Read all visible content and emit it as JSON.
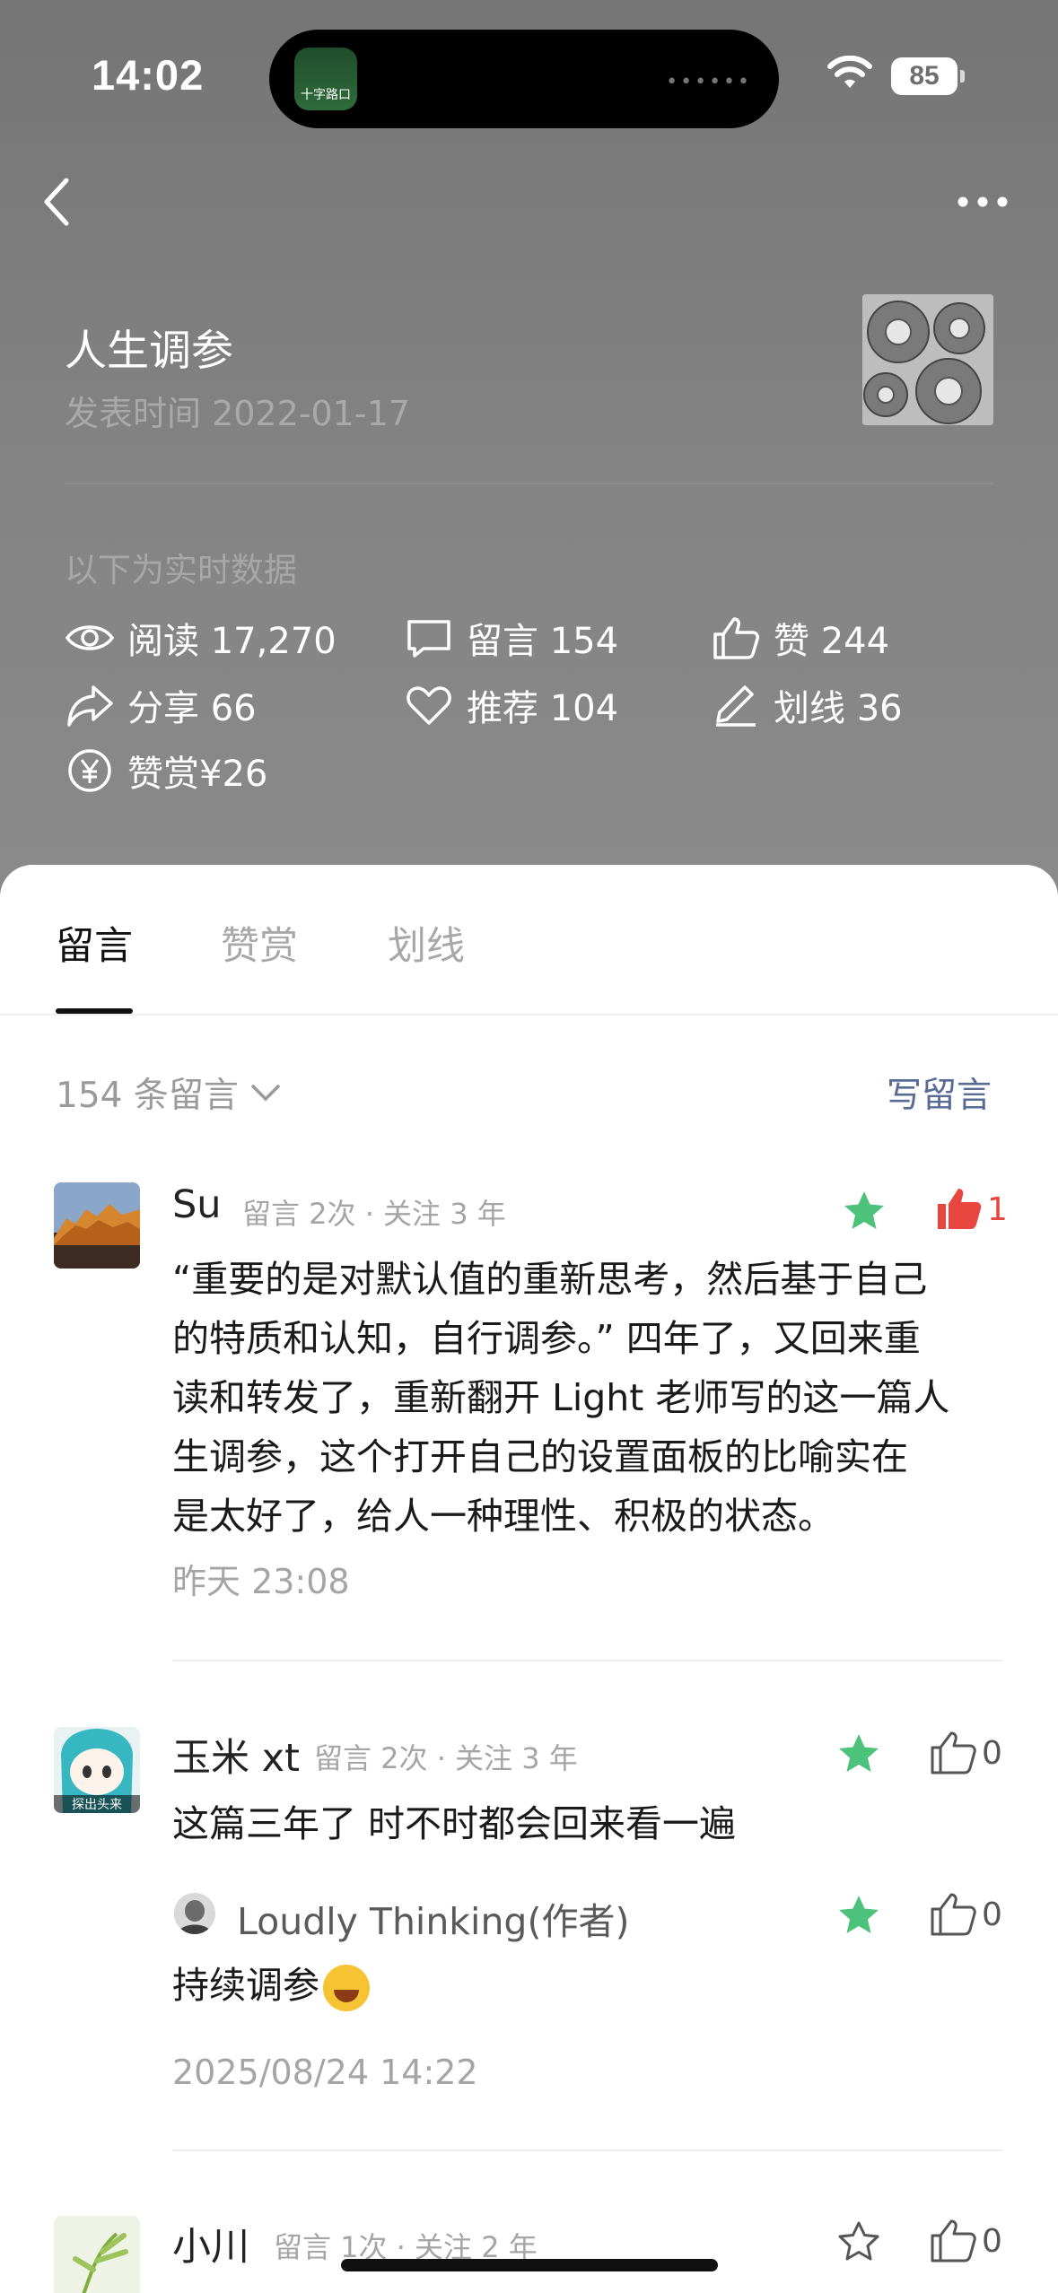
{
  "status_bar": {
    "time": "14:02",
    "battery": "85",
    "island_app_label": "十字路口"
  },
  "article": {
    "title": "人生调参",
    "date": "发表时间 2022-01-17"
  },
  "realtime_label": "以下为实时数据",
  "stats": {
    "read": "阅读 17,270",
    "comments": "留言 154",
    "likes": "赞 244",
    "shares": "分享 66",
    "recommend": "推荐 104",
    "highlights": "划线 36",
    "tips": "赞赏¥26"
  },
  "tabs": [
    "留言",
    "赞赏",
    "划线"
  ],
  "comment_count_label": "154 条留言",
  "write_comment_label": "写留言",
  "comments": [
    {
      "name": "Su",
      "meta": "留言 2次 · 关注 3 年",
      "lines": [
        "“重要的是对默认值的重新思考，然后基于自己",
        "的特质和认知，自行调参。” 四年了，又回来重",
        "读和转发了，重新翻开 Light 老师写的这一篇人",
        "生调参，这个打开自己的设置面板的比喻实在",
        "是太好了，给人一种理性、积极的状态。"
      ],
      "time": "昨天 23:08",
      "likes": "1",
      "starred": true,
      "liked": true
    },
    {
      "name": "玉米 xt",
      "meta": "留言 2次 · 关注 3 年",
      "text": "这篇三年了 时不时都会回来看一遍",
      "likes": "0",
      "starred": true,
      "avatar_caption": "探出头来",
      "reply": {
        "name": "Loudly Thinking(作者)",
        "text": "持续调参",
        "likes": "0"
      },
      "time": "2025/08/24 14:22"
    },
    {
      "name": "小川",
      "meta": "留言 1次 · 关注 2 年",
      "likes": "0",
      "starred": false
    }
  ],
  "colors": {
    "accent_link": "#576b95",
    "star_green": "#4cc27a",
    "like_red": "#e8473f"
  }
}
